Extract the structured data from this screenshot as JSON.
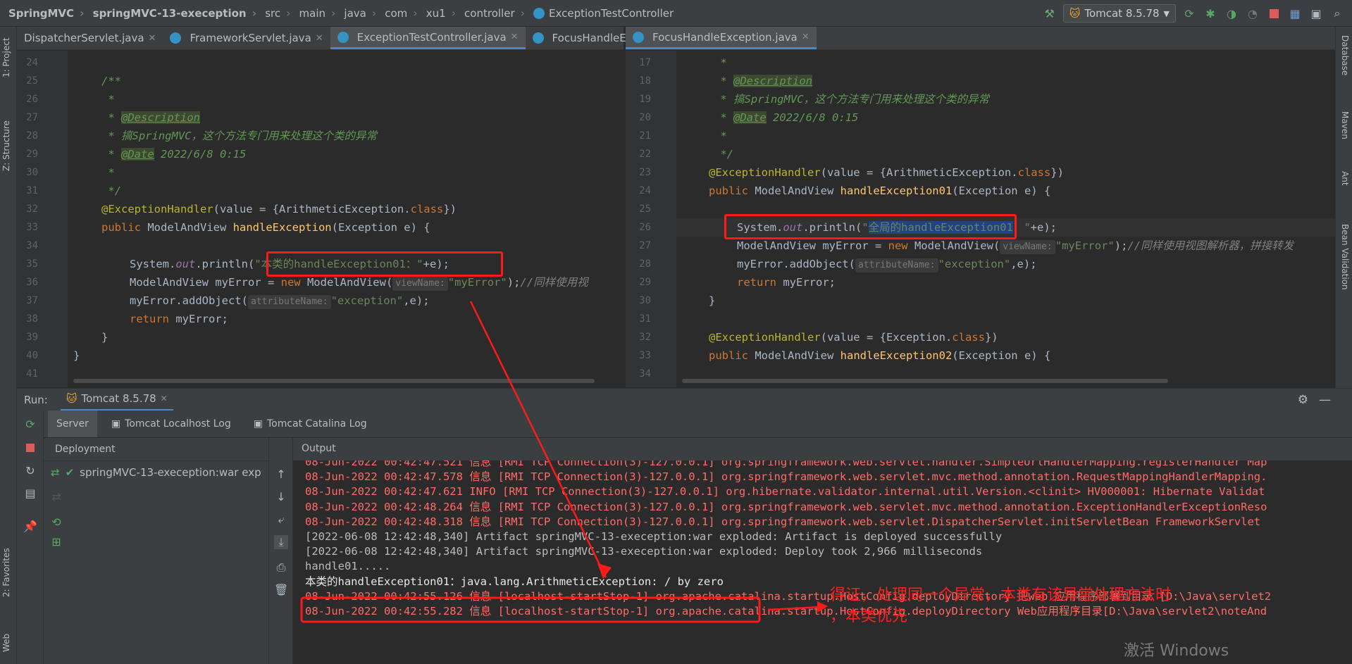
{
  "breadcrumb": [
    "SpringMVC",
    "springMVC-13-exeception",
    "src",
    "main",
    "java",
    "com",
    "xu1",
    "controller",
    "ExceptionTestController"
  ],
  "run_config": "Tomcat 8.5.78",
  "left_strip": {
    "project": "1: Project",
    "structure": "Z: Structure",
    "favorites": "2: Favorites",
    "web": "Web"
  },
  "right_strip": {
    "database": "Database",
    "maven": "Maven",
    "ant": "Ant",
    "bean_validation": "Bean Validation"
  },
  "left_tabs": [
    {
      "label": "DispatcherServlet.java"
    },
    {
      "label": "FrameworkServlet.java"
    },
    {
      "label": "ExceptionTestController.java"
    },
    {
      "label": "FocusHandleE"
    }
  ],
  "right_tabs": [
    {
      "label": "FocusHandleException.java"
    }
  ],
  "left_editor": {
    "line_numbers": [
      "24",
      "25",
      "26",
      "27",
      "28",
      "29",
      "30",
      "31",
      "32",
      "33",
      "34",
      "35",
      "36",
      "37",
      "38",
      "39",
      "40",
      "41"
    ],
    "lines": {
      "l25": "/**",
      "l26": " *",
      "l27_pre": " * ",
      "l27_tag": "@Description",
      "l28": " * 搞SpringMVC，这个方法专门用来处理这个类的异常",
      "l29_pre": " * ",
      "l29_tag": "@Date",
      "l29_post": " 2022/6/8 0:15",
      "l30": " *",
      "l31": " */",
      "l32_ann": "@ExceptionHandler",
      "l32_a": "(value = {ArithmeticException.",
      "l32_kw": "class",
      "l32_b": "})",
      "l33_kw": "public",
      "l33_a": " ModelAndView ",
      "l33_fn": "handleException",
      "l33_b": "(Exception e) {",
      "l35_a": "System.",
      "l35_field": "out",
      "l35_b": ".println(",
      "l35_str": "\"本类的handleException01：\"",
      "l35_c": "+e);",
      "l36_a": "ModelAndView myError = ",
      "l36_kw": "new",
      "l36_b": " ModelAndView(",
      "l36_hint": "viewName:",
      "l36_str": "\"myError\"",
      "l36_c": ");",
      "l36_cm": "//同样使用视",
      "l37_a": "myError.addObject(",
      "l37_hint": "attributeName:",
      "l37_str": "\"exception\"",
      "l37_b": ",e);",
      "l38_kw": "return",
      "l38_a": " myError;",
      "l39": "}",
      "l40": "}"
    }
  },
  "right_editor": {
    "line_numbers": [
      "17",
      "18",
      "19",
      "20",
      "21",
      "22",
      "23",
      "24",
      "25",
      "26",
      "27",
      "28",
      "29",
      "30",
      "31",
      "32",
      "33",
      "34"
    ],
    "lines": {
      "l17": " *",
      "l18_pre": " * ",
      "l18_tag": "@Description",
      "l19": " * 搞SpringMVC，这个方法专门用来处理这个类的异常",
      "l20_pre": " * ",
      "l20_tag": "@Date",
      "l20_post": " 2022/6/8 0:15",
      "l21": " *",
      "l22": " */",
      "l23_ann": "@ExceptionHandler",
      "l23_a": "(value = {ArithmeticException.",
      "l23_kw": "class",
      "l23_b": "})",
      "l24_kw": "public",
      "l24_a": " ModelAndView ",
      "l24_fn": "handleException01",
      "l24_b": "(Exception e) {",
      "l26_a": "System.",
      "l26_field": "out",
      "l26_b": ".println(",
      "l26_q1": "\"",
      "l26_sel": "全局的handleException01",
      "l26_q2": "：\"",
      "l26_c": "+e);",
      "l27_a": "ModelAndView myError = ",
      "l27_kw": "new",
      "l27_b": " ModelAndView(",
      "l27_hint": "viewName:",
      "l27_str": "\"myError\"",
      "l27_c": ");",
      "l27_cm": "//同样使用视图解析器，拼接转发",
      "l28_a": "myError.addObject(",
      "l28_hint": "attributeName:",
      "l28_str": "\"exception\"",
      "l28_b": ",e);",
      "l29_kw": "return",
      "l29_a": " myError;",
      "l30": "}",
      "l32_ann": "@ExceptionHandler",
      "l32_a": "(value = {Exception.",
      "l32_kw": "class",
      "l32_b": "})",
      "l33_kw": "public",
      "l33_a": " ModelAndView ",
      "l33_fn": "handleException02",
      "l33_b": "(Exception e) {"
    }
  },
  "run_panel": {
    "run_label": "Run:",
    "run_tab": "Tomcat 8.5.78",
    "sub_tabs": [
      "Server",
      "Tomcat Localhost Log",
      "Tomcat Catalina Log"
    ],
    "deployment_label": "Deployment",
    "output_label": "Output",
    "artifact": "springMVC-13-exeception:war exp"
  },
  "output_lines": [
    {
      "text": "08-Jun-2022 00:42:47.521 信息 [RMI TCP Connection(3)-127.0.0.1] org.springframework.web.servlet.handler.SimpleUrlHandlerMapping.registerHandler Map",
      "color": "red"
    },
    {
      "text": "08-Jun-2022 00:42:47.578 信息 [RMI TCP Connection(3)-127.0.0.1] org.springframework.web.servlet.mvc.method.annotation.RequestMappingHandlerMapping.",
      "color": "red"
    },
    {
      "text": "08-Jun-2022 00:42:47.621 INFO [RMI TCP Connection(3)-127.0.0.1] org.hibernate.validator.internal.util.Version.<clinit> HV000001: Hibernate Validat",
      "color": "red"
    },
    {
      "text": "08-Jun-2022 00:42:48.264 信息 [RMI TCP Connection(3)-127.0.0.1] org.springframework.web.servlet.mvc.method.annotation.ExceptionHandlerExceptionReso",
      "color": "red"
    },
    {
      "text": "08-Jun-2022 00:42:48.318 信息 [RMI TCP Connection(3)-127.0.0.1] org.springframework.web.servlet.DispatcherServlet.initServletBean FrameworkServlet",
      "color": "red"
    },
    {
      "text": "[2022-06-08 12:42:48,340] Artifact springMVC-13-exeception:war exploded: Artifact is deployed successfully",
      "color": "gray"
    },
    {
      "text": "[2022-06-08 12:42:48,340] Artifact springMVC-13-exeception:war exploded: Deploy took 2,966 milliseconds",
      "color": "gray"
    },
    {
      "text": "handle01.....",
      "color": "gray"
    },
    {
      "text": "本类的handleException01：java.lang.ArithmeticException: / by zero",
      "color": "white"
    },
    {
      "text": "08-Jun-2022 00:42:55.126 信息 [localhost-startStop-1] org.apache.catalina.startup.HostConfig.deployDirectory 把web 应用程序部署到目录 [D:\\Java\\servlet2",
      "color": "red"
    },
    {
      "text": "08-Jun-2022 00:42:55.282 信息 [localhost-startStop-1] org.apache.catalina.startup.HostConfig.deployDirectory Web应用程序目录[D:\\Java\\servlet2\\noteAnd",
      "color": "red"
    }
  ],
  "annotation": {
    "line1": "得证，处理同一个异常，本类有该异常处理方法时",
    "line2": "，本类优先"
  },
  "watermark": "激活 Windows"
}
